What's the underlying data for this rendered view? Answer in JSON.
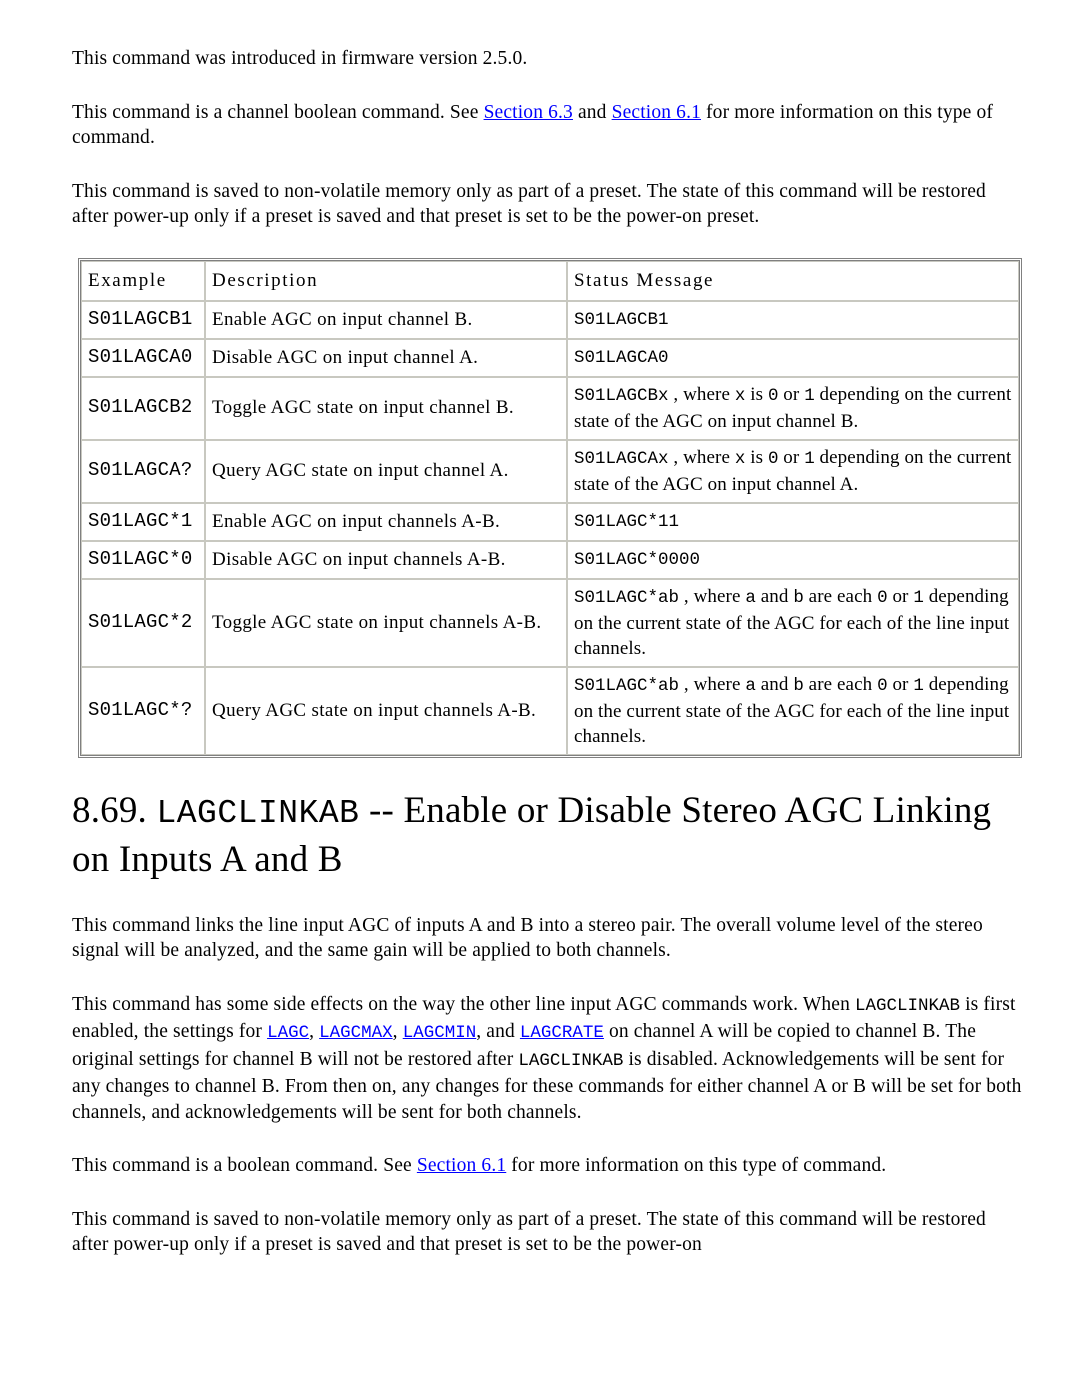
{
  "paragraphs_top": [
    {
      "id": "firmware-version",
      "runs": [
        {
          "type": "text",
          "text": "This command was introduced in firmware version 2.5.0."
        }
      ]
    },
    {
      "id": "channel-boolean",
      "runs": [
        {
          "type": "text",
          "text": "This command is a channel boolean command. See "
        },
        {
          "type": "link",
          "text": "Section 6.3"
        },
        {
          "type": "text",
          "text": " and "
        },
        {
          "type": "link",
          "text": "Section 6.1"
        },
        {
          "type": "text",
          "text": " for more information on this type of command."
        }
      ]
    },
    {
      "id": "preset-memory",
      "runs": [
        {
          "type": "text",
          "text": "This command is saved to non-volatile memory only as part of a preset. The state of this command will be restored after power-up only if a preset is saved and that preset is set to be the power-on preset."
        }
      ]
    }
  ],
  "table": {
    "name": "lagc-command-examples",
    "headers": [
      "Example",
      "Description",
      "Status Message"
    ],
    "rows": [
      {
        "example": "S01LAGCB1",
        "description": "Enable AGC on input channel B.",
        "status_runs": [
          {
            "type": "mono",
            "text": "S01LAGCB1"
          }
        ]
      },
      {
        "example": "S01LAGCA0",
        "description": "Disable AGC on input channel A.",
        "status_runs": [
          {
            "type": "mono",
            "text": "S01LAGCA0"
          }
        ]
      },
      {
        "example": "S01LAGCB2",
        "description": "Toggle AGC state on input channel B.",
        "status_runs": [
          {
            "type": "mono",
            "text": "S01LAGCBx"
          },
          {
            "type": "text",
            "text": " , where "
          },
          {
            "type": "mono",
            "text": "x"
          },
          {
            "type": "text",
            "text": " is "
          },
          {
            "type": "mono",
            "text": "0"
          },
          {
            "type": "text",
            "text": " or "
          },
          {
            "type": "mono",
            "text": "1"
          },
          {
            "type": "text",
            "text": " depending on the current state of the AGC on input channel B."
          }
        ]
      },
      {
        "example": "S01LAGCA?",
        "description": "Query AGC state on input channel A.",
        "status_runs": [
          {
            "type": "mono",
            "text": "S01LAGCAx"
          },
          {
            "type": "text",
            "text": " , where "
          },
          {
            "type": "mono",
            "text": "x"
          },
          {
            "type": "text",
            "text": " is "
          },
          {
            "type": "mono",
            "text": "0"
          },
          {
            "type": "text",
            "text": " or "
          },
          {
            "type": "mono",
            "text": "1"
          },
          {
            "type": "text",
            "text": " depending on the current state of the AGC on input channel A."
          }
        ]
      },
      {
        "example": "S01LAGC*1",
        "description": "Enable AGC on input channels A-B.",
        "status_runs": [
          {
            "type": "mono",
            "text": "S01LAGC*11"
          }
        ]
      },
      {
        "example": "S01LAGC*0",
        "description": "Disable AGC on input channels A-B.",
        "status_runs": [
          {
            "type": "mono",
            "text": "S01LAGC*0000"
          }
        ]
      },
      {
        "example": "S01LAGC*2",
        "description": "Toggle AGC state on input channels A-B.",
        "status_runs": [
          {
            "type": "mono",
            "text": "S01LAGC*ab"
          },
          {
            "type": "text",
            "text": " , where "
          },
          {
            "type": "mono",
            "text": "a"
          },
          {
            "type": "text",
            "text": " and "
          },
          {
            "type": "mono",
            "text": "b"
          },
          {
            "type": "text",
            "text": " are each "
          },
          {
            "type": "mono",
            "text": "0"
          },
          {
            "type": "text",
            "text": " or "
          },
          {
            "type": "mono",
            "text": "1"
          },
          {
            "type": "text",
            "text": " depending on the current state of the AGC for each of the line input channels."
          }
        ]
      },
      {
        "example": "S01LAGC*?",
        "description": "Query AGC state on input channels A-B.",
        "status_runs": [
          {
            "type": "mono",
            "text": "S01LAGC*ab"
          },
          {
            "type": "text",
            "text": " , where "
          },
          {
            "type": "mono",
            "text": "a"
          },
          {
            "type": "text",
            "text": " and "
          },
          {
            "type": "mono",
            "text": "b"
          },
          {
            "type": "text",
            "text": " are each "
          },
          {
            "type": "mono",
            "text": "0"
          },
          {
            "type": "text",
            "text": " or "
          },
          {
            "type": "mono",
            "text": "1"
          },
          {
            "type": "text",
            "text": " depending on the current state of the AGC for each of the line input channels."
          }
        ]
      }
    ]
  },
  "heading": {
    "number": "8.69.",
    "command": "LAGCLINKAB",
    "separator": "--",
    "title": "Enable or Disable Stereo AGC Linking on Inputs A and B"
  },
  "paragraphs_bottom": [
    {
      "id": "stereo-pair",
      "runs": [
        {
          "type": "text",
          "text": "This command links the line input AGC of inputs A and B into a stereo pair. The overall volume level of the stereo signal will be analyzed, and the same gain will be applied to both channels."
        }
      ]
    },
    {
      "id": "side-effects",
      "runs": [
        {
          "type": "text",
          "text": "This command has some side effects on the way the other line input AGC commands work. When "
        },
        {
          "type": "mono",
          "text": "LAGCLINKAB"
        },
        {
          "type": "text",
          "text": " is first enabled, the settings for "
        },
        {
          "type": "monolink",
          "text": "LAGC"
        },
        {
          "type": "text",
          "text": ", "
        },
        {
          "type": "monolink",
          "text": "LAGCMAX"
        },
        {
          "type": "text",
          "text": ", "
        },
        {
          "type": "monolink",
          "text": "LAGCMIN"
        },
        {
          "type": "text",
          "text": ", and "
        },
        {
          "type": "monolink",
          "text": "LAGCRATE"
        },
        {
          "type": "text",
          "text": " on channel A will be copied to channel B. The original settings for channel B will not be restored after "
        },
        {
          "type": "mono",
          "text": "LAGCLINKAB"
        },
        {
          "type": "text",
          "text": " is disabled. Acknowledgements will be sent for any changes to channel B. From then on, any changes for these commands for either channel A or B will be set for both channels, and acknowledgements will be sent for both channels."
        }
      ]
    },
    {
      "id": "boolean-command",
      "runs": [
        {
          "type": "text",
          "text": "This command is a boolean command. See "
        },
        {
          "type": "link",
          "text": "Section 6.1"
        },
        {
          "type": "text",
          "text": " for more information on this type of command."
        }
      ]
    },
    {
      "id": "preset-memory-bottom",
      "runs": [
        {
          "type": "text",
          "text": "This command is saved to non-volatile memory only as part of a preset. The state of this command will be restored after power-up only if a preset is saved and that preset is set to be the power-on"
        }
      ]
    }
  ],
  "colors": {
    "link": "#0000ff",
    "text": "#000000",
    "table_border": "#808080",
    "cell_border": "#c8c8c0"
  }
}
